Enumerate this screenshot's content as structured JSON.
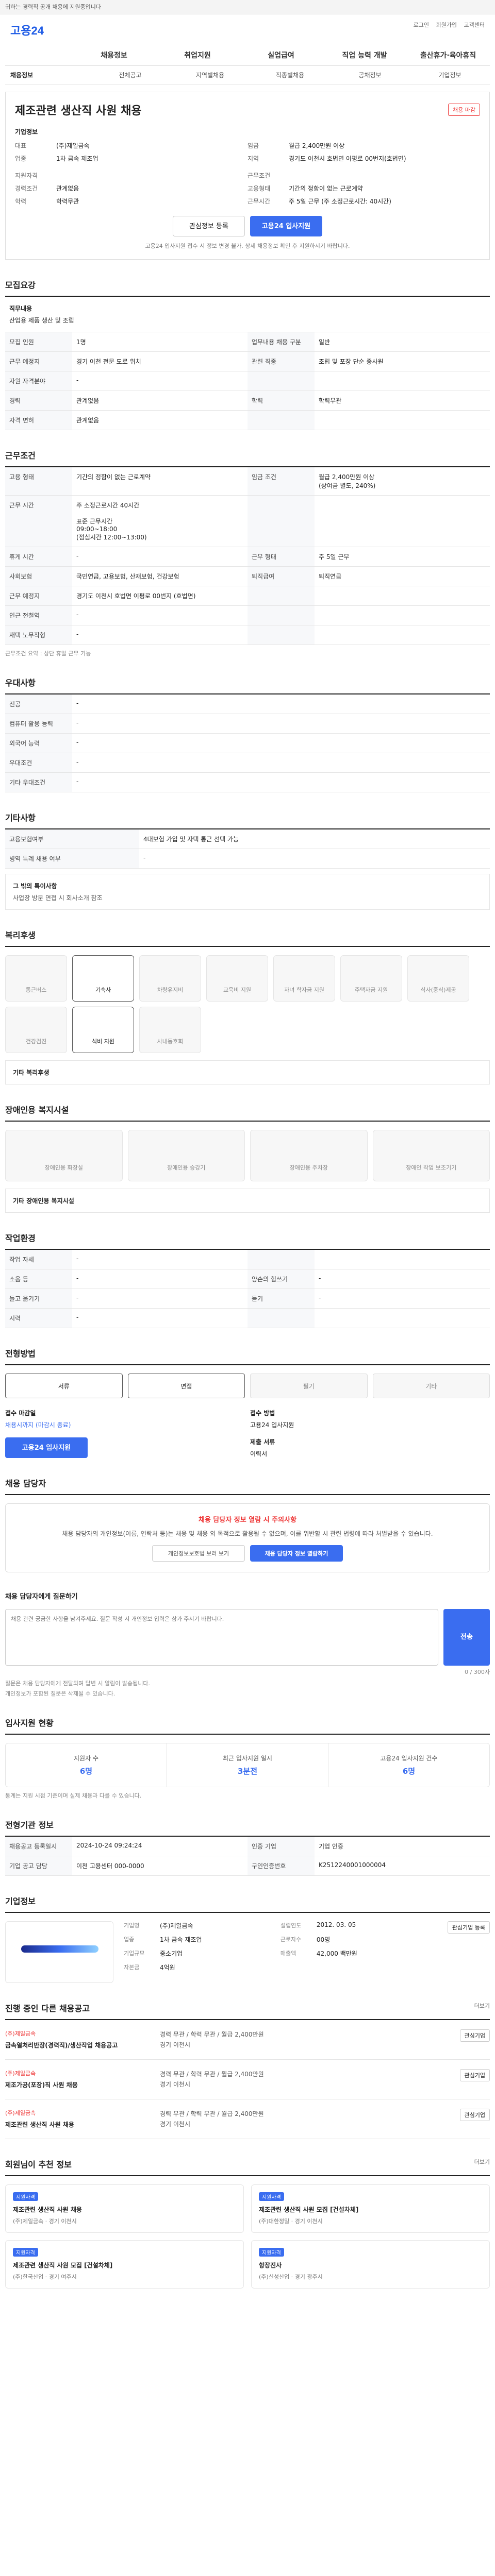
{
  "topbar": {
    "text": "귀하는 경력직 공개 채용에 지원중입니다"
  },
  "header": {
    "logo": "고용24",
    "links": [
      "로그인",
      "회원가입",
      "고객센터"
    ]
  },
  "gnb": [
    "채용정보",
    "취업지원",
    "실업급여",
    "직업 능력 개발",
    "출산휴가·육아휴직"
  ],
  "subnav": [
    "채용정보",
    "전체공고",
    "지역별채용",
    "직종별채용",
    "공채정보",
    "기업정보"
  ],
  "job": {
    "badge": "채용 마감",
    "title": "제조관련 생산직 사원 채용",
    "company_label": "기업정보",
    "company": "(주)제일금속",
    "ceo_label": "대표",
    "ceo": "김철호",
    "industry_label": "업종",
    "industry": "1차 금속 제조업",
    "wage_label": "임금",
    "wage": "월급 2,400만원 이상",
    "loc_label": "지역",
    "loc": "경기도 이천시 호법면 이평로 00번지(호법면)",
    "cond_title": "지원자격",
    "cond_exp_label": "경력조건",
    "cond_exp": "관계없음",
    "cond_edu_label": "학력",
    "cond_edu": "학력무관",
    "work_title": "근무조건",
    "work_type_label": "고용형태",
    "work_type": "기간의 정함이 없는 근로계약",
    "work_hours_label": "근무시간",
    "work_hours": "주 5일 근무 (주 소정근로시간: 40시간)",
    "btn_scrap": "관심정보 등록",
    "btn_apply": "고용24 입사지원",
    "note": "고용24 입사지원 접수 시 정보 변경 불가. 상세 채용정보 확인 후 지원하시기 바랍니다."
  },
  "recruit": {
    "title": "모집요강",
    "job_label": "직무내용",
    "job_text": "산업용 제품 생산 및 조립",
    "rows": [
      {
        "k": "모집 인원",
        "v": "1명",
        "k2": "업무내용 채용 구분",
        "v2": "일반"
      },
      {
        "k": "근무 예정지",
        "v": "경기 이천 전문 도로 위치",
        "k2": "관련 직종",
        "v2": "조립 및 포장 단순 종사원"
      },
      {
        "k": "자원 자격분야",
        "v": "-",
        "k2": "",
        "v2": ""
      },
      {
        "k": "경력",
        "v": "관계없음",
        "k2": "학력",
        "v2": "학력무관"
      },
      {
        "k": "자격 면허",
        "v": "관계없음",
        "k2": "",
        "v2": ""
      }
    ]
  },
  "work": {
    "title": "근무조건",
    "rows": [
      {
        "k": "고용 형태",
        "v": "기간의 정함이 없는 근로계약",
        "k2": "임금 조건",
        "v2": "월급 2,400만원 이상\n(상여금 별도, 240%)"
      },
      {
        "k": "근무 시간",
        "v": "주 소정근로시간 40시간\n\n표준 근무시간\n09:00~18:00\n(점심시간 12:00~13:00)",
        "k2": "",
        "v2": ""
      },
      {
        "k": "휴게 시간",
        "v": "-",
        "k2": "근무 형태",
        "v2": "주 5일 근무"
      },
      {
        "k": "사회보험",
        "v": "국민연금, 고용보험, 산재보험, 건강보험",
        "k2": "퇴직급여",
        "v2": "퇴직연금"
      },
      {
        "k": "근무 예정지",
        "v": "경기도 이천시 호법면 이평로 00번지 (호법면)",
        "k2": "",
        "v2": ""
      },
      {
        "k": "인근 전철역",
        "v": "-",
        "k2": "",
        "v2": ""
      },
      {
        "k": "재택 노무작형",
        "v": "-",
        "k2": "",
        "v2": ""
      }
    ],
    "note": "근무조건 요약 : 상단 휴일 근무 가능"
  },
  "prefer": {
    "title": "우대사항",
    "rows": [
      "전공",
      "컴퓨터 활용 능력",
      "외국어 능력",
      "우대조건",
      "기타 우대조건"
    ]
  },
  "etc": {
    "title": "기타사항",
    "rows": [
      {
        "k": "고용보험여부",
        "v": "4대보험 가입 및 자택 통근 선택 가능"
      },
      {
        "k": "병역 특례 채용 여부",
        "v": "-"
      }
    ],
    "text_title": "그 밖의 특이사항",
    "text": "사업장 방문 면접 시 회사소개 참조"
  },
  "welfare": {
    "title": "복리후생",
    "items": [
      "통근버스",
      "기숙사",
      "차량유지비",
      "교육비 지원",
      "자녀 학자금 지원",
      "주택자금 지원",
      "식사(중식)제공",
      "건강검진",
      "식비 지원",
      "사내동호회"
    ],
    "on_index": [
      1,
      8
    ],
    "other_label": "기타 복리후생"
  },
  "disab": {
    "title": "장애인용 복지시설",
    "items": [
      "장애인용 화장실",
      "장애인용 승강기",
      "장애인용 주차장",
      "장애인 작업 보조기기"
    ],
    "other_label": "기타 장애인용 복지시설"
  },
  "workenv": {
    "title": "작업환경",
    "rows": [
      {
        "k": "작업 자세",
        "v": "-",
        "k2": "",
        "v2": ""
      },
      {
        "k": "소음 등",
        "v": "-",
        "k2": "양손의 힘쓰기",
        "v2": "-"
      },
      {
        "k": "들고 옮기기",
        "v": "-",
        "k2": "듣기",
        "v2": "-"
      },
      {
        "k": "시력",
        "v": "-",
        "k2": "",
        "v2": ""
      }
    ]
  },
  "apply": {
    "title": "전형방법",
    "methods": [
      "서류",
      "면접",
      "필기",
      "기타"
    ],
    "on": [
      0,
      1
    ],
    "deadline_label": "접수 마감일",
    "deadline": "채용시까지 (마감시 종료)",
    "howto_label": "접수 방법",
    "howto": "고용24 입사지원",
    "btn": "고용24 입사지원",
    "docs_label": "제출 서류",
    "docs": "이력서"
  },
  "manager": {
    "title": "채용 담당자",
    "alert": "채용 담당자 정보 열람 시 주의사항",
    "text": "채용 담당자의 개인정보(이름, 연락처 등)는 채용 및 채용 외 목적으로 활용될 수 없으며, 이를 위반할 시 관련 법령에 따라 처벌받을 수 있습니다.",
    "btn1": "개인정보보호법 보러 보기",
    "btn2": "채용 담당자 정보 열람하기"
  },
  "qa": {
    "title": "채용 담당자에게 질문하기",
    "placeholder": "채용 관련 궁금한 사항을 남겨주세요. 질문 작성 시 개인정보 입력은 삼가 주시기 바랍니다.",
    "count": "0 / 300자",
    "send": "전송",
    "notes": [
      "질문은 채용 담당자에게 전달되며 답변 시 알림이 발송됩니다.",
      "개인정보가 포함된 질문은 삭제될 수 있습니다."
    ]
  },
  "stats": {
    "title": "입사지원 현황",
    "items": [
      {
        "k": "지원자 수",
        "v": "6명"
      },
      {
        "k": "최근 입사지원 일시",
        "v": "3분전"
      },
      {
        "k": "고용24 입사지원 건수",
        "v": "6명"
      }
    ],
    "note": "통계는 지원 시점 기준이며 실제 채용과 다를 수 있습니다."
  },
  "info": {
    "title": "전형기관 정보",
    "rows": [
      {
        "k": "채용공고 등록일시",
        "v": "2024-10-24 09:24:24",
        "k2": "인증 기업",
        "v2": "기업 인증"
      },
      {
        "k": "기업 공고 담당",
        "v": "이천 고용센터 000-0000",
        "k2": "구인인증번호",
        "v2": "K2512240001000004"
      }
    ]
  },
  "corp": {
    "title": "기업정보",
    "name_label": "기업명",
    "name": "(주)제일금속",
    "biz_label": "업종",
    "biz": "1차 금속 제조업",
    "size_label": "기업규모",
    "size": "중소기업",
    "found_label": "설립연도",
    "found": "2012. 03. 05",
    "emp_label": "근로자수",
    "emp": "00명",
    "sales_label": "매출액",
    "sales": "42,000 백만원",
    "cap_label": "자본금",
    "cap": "4억원",
    "btn": "관심기업 등록"
  },
  "jobs": {
    "title": "진행 중인 다른 채용공고",
    "more": "더보기",
    "list": [
      {
        "co": "(주)제일금속",
        "t": "금속열처리반장(경력직)/생산작업 채용공고",
        "d": "경력 무관 / 학력 무관 / 월급 2,400만원",
        "l": "경기 이천시"
      },
      {
        "co": "(주)제일금속",
        "t": "제조가공(포장)직 사원 채용",
        "d": "경력 무관 / 학력 무관 / 월급 2,400만원",
        "l": "경기 이천시"
      },
      {
        "co": "(주)제일금속",
        "t": "제조관련 생산직 사원 채용",
        "d": "경력 무관 / 학력 무관 / 월급 2,400만원",
        "l": "경기 이천시"
      }
    ],
    "btn": "관심기업"
  },
  "recommend": {
    "title": "회원님이 추천 정보",
    "more": "더보기",
    "list": [
      {
        "tag": "지원자격",
        "t": "제조관련 생산직 사원 채용",
        "s": "(주)제일금속 · 경기 이천시"
      },
      {
        "tag": "지원자격",
        "t": "제조관련 생산직 사원 모집 [건설차체]",
        "s": "(주)대한정밀 · 경기 이천시"
      },
      {
        "tag": "지원자격",
        "t": "제조관련 생산직 사원 모집 [건설차체]",
        "s": "(주)한국산업 · 경기 여주시"
      },
      {
        "tag": "지원자격",
        "t": "항장진사",
        "s": "(주)신성산업 · 경기 광주시"
      }
    ]
  }
}
